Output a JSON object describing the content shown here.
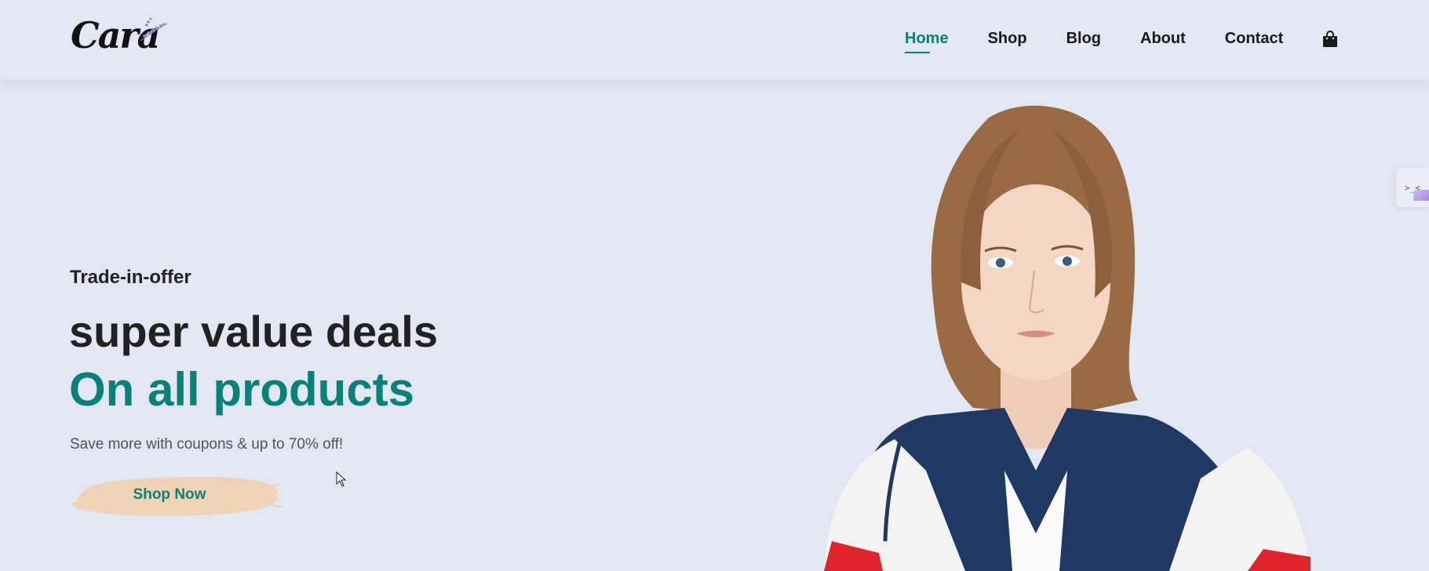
{
  "brand": {
    "logo_text": "Cara"
  },
  "nav": {
    "items": [
      {
        "label": "Home",
        "active": true
      },
      {
        "label": "Shop",
        "active": false
      },
      {
        "label": "Blog",
        "active": false
      },
      {
        "label": "About",
        "active": false
      },
      {
        "label": "Contact",
        "active": false
      }
    ],
    "cart_icon": "shopping-bag-icon"
  },
  "side_tab": {
    "label": ">_<"
  },
  "hero": {
    "subtitle": "Trade-in-offer",
    "title": "super value deals",
    "title_accent": "On all products",
    "description": "Save more with coupons & up to 70% off!",
    "button_label": "Shop Now"
  },
  "colors": {
    "background": "#e3e6f3",
    "accent": "#088178",
    "button_brush": "#f0d2b4",
    "text_dark": "#222222"
  }
}
